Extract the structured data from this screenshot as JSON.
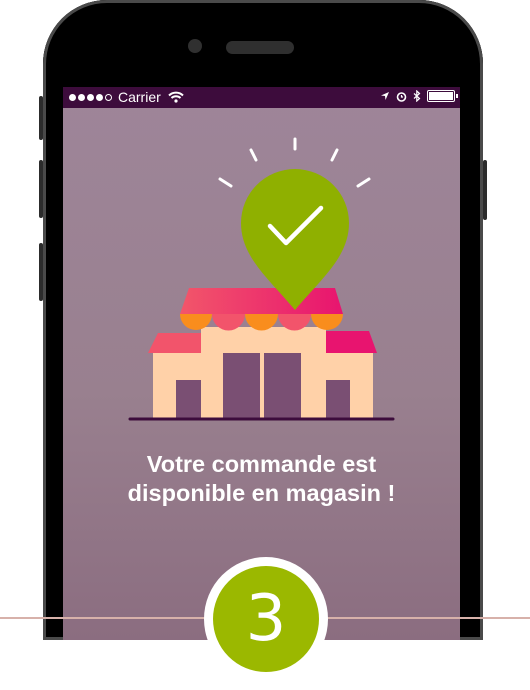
{
  "status_bar": {
    "carrier": "Carrier",
    "icons": [
      "signal-dots-icon",
      "wifi-icon",
      "location-arrow-icon",
      "alarm-clock-icon",
      "bluetooth-icon",
      "battery-icon"
    ]
  },
  "message": {
    "line1": "Votre commande est",
    "line2": "disponible en magasin !"
  },
  "step": {
    "number": "3"
  },
  "colors": {
    "screen_bg": "#9e8599",
    "status_bar_bg": "#3d0c3c",
    "pin_green": "#8fb000",
    "step_badge_green": "#9bb800",
    "awning_red": "#ec3d5c",
    "awning_orange": "#f98d1d",
    "shop_wall": "#ffd1a8",
    "shop_door": "#7a4f73",
    "divider": "#d7b1aa"
  }
}
